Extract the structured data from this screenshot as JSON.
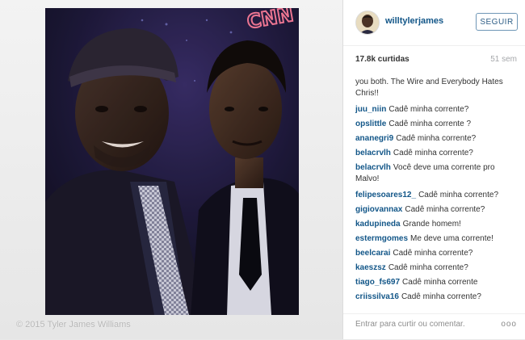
{
  "post": {
    "username": "willtylerjames",
    "follow_label": "SEGUIR",
    "likes": "17.8k curtidas",
    "time_ago": "51 sem",
    "caption_tail": "you both. The Wire and Everybody Hates Chris!!",
    "watermark": "© 2015 Tyler James Williams",
    "comment_placeholder": "Entrar para curtir ou comentar.",
    "more_icon": "ooo"
  },
  "photo": {
    "sign_text": "CNN"
  },
  "comments": [
    {
      "user": "juu_niin",
      "text": "Cadê minha corrente?"
    },
    {
      "user": "opslittle",
      "text": "Cadê minha corrente ?"
    },
    {
      "user": "ananegri9",
      "text": "Cadê minha corrente?"
    },
    {
      "user": "belacrvlh",
      "text": "Cadê minha corrente?"
    },
    {
      "user": "belacrvlh",
      "text": "Você deve uma corrente pro Malvo!"
    },
    {
      "user": "felipesoares12_",
      "text": "Cadê minha corrente?"
    },
    {
      "user": "gigiovannax",
      "text": "Cadê minha corrente?"
    },
    {
      "user": "kadupineda",
      "text": "Grande homem!"
    },
    {
      "user": "estermgomes",
      "text": "Me deve uma corrente!"
    },
    {
      "user": "beelcarai",
      "text": "Cadê minha corrente?"
    },
    {
      "user": "kaeszsz",
      "text": "Cadê minha corrente?"
    },
    {
      "user": "tiago_fs697",
      "text": "Cadê minha corrente"
    },
    {
      "user": "criissilva16",
      "text": "Cadê minha corrente?"
    }
  ],
  "colors": {
    "username": "#125688",
    "follow_border": "#6f97b6"
  },
  "icons": {
    "more": "more-options-icon"
  }
}
